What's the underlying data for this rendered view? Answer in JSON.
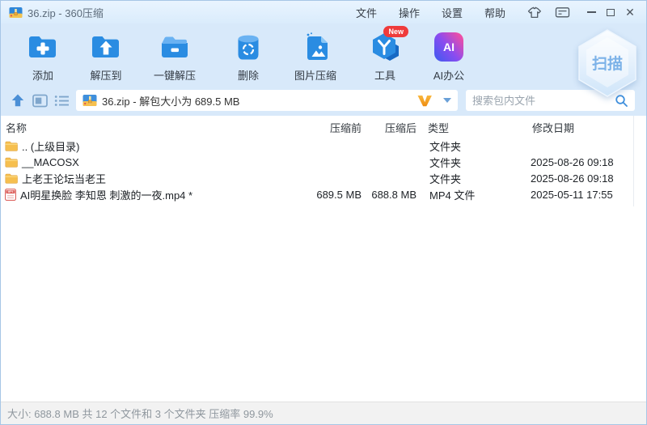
{
  "window": {
    "title": "36.zip - 360压缩"
  },
  "titlebar": {
    "menu": [
      "文件",
      "操作",
      "设置",
      "帮助"
    ]
  },
  "toolbar": {
    "buttons": [
      {
        "icon": "folder-add-icon",
        "label": "添加"
      },
      {
        "icon": "folder-extract-icon",
        "label": "解压到"
      },
      {
        "icon": "folder-open-icon",
        "label": "一键解压"
      },
      {
        "icon": "trash-icon",
        "label": "删除"
      },
      {
        "icon": "image-file-icon",
        "label": "图片压缩"
      },
      {
        "icon": "hexagon-tool-icon",
        "label": "工具",
        "badge": "New"
      },
      {
        "icon": "ai-tile-icon",
        "label": "AI办公"
      }
    ],
    "scan_label": "扫描"
  },
  "pathbar": {
    "path": "36.zip - 解包大小为 689.5 MB",
    "search_placeholder": "搜索包内文件"
  },
  "filelist": {
    "columns": [
      "名称",
      "压缩前",
      "压缩后",
      "类型",
      "修改日期"
    ],
    "rows": [
      {
        "icon": "folder",
        "name": ".. (上级目录)",
        "size_before": "",
        "size_after": "",
        "type": "文件夹",
        "modified": ""
      },
      {
        "icon": "folder",
        "name": "__MACOSX",
        "size_before": "",
        "size_after": "",
        "type": "文件夹",
        "modified": "2025-08-26 09:18"
      },
      {
        "icon": "folder",
        "name": "上老王论坛当老王",
        "size_before": "",
        "size_after": "",
        "type": "文件夹",
        "modified": "2025-08-26 09:18"
      },
      {
        "icon": "mp4",
        "name": "AI明星换脸 李知恩 刺激的一夜.mp4 *",
        "size_before": "689.5 MB",
        "size_after": "688.8 MB",
        "type": "MP4 文件",
        "modified": "2025-05-11 17:55"
      }
    ]
  },
  "statusbar": {
    "text": "大小: 688.8 MB 共 12 个文件和 3 个文件夹 压缩率 99.9%"
  },
  "colors": {
    "accent_blue": "#2a8ce2",
    "titlebar_bg": "#e3f0fd",
    "toolbar_bg": "#d8e9fa",
    "folder_yellow": "#f6bf4f",
    "mp4_red": "#d9534f",
    "badge_red": "#ef3b3b",
    "v_orange": "#f49d1d",
    "scan_text": "#7cb2e8"
  }
}
